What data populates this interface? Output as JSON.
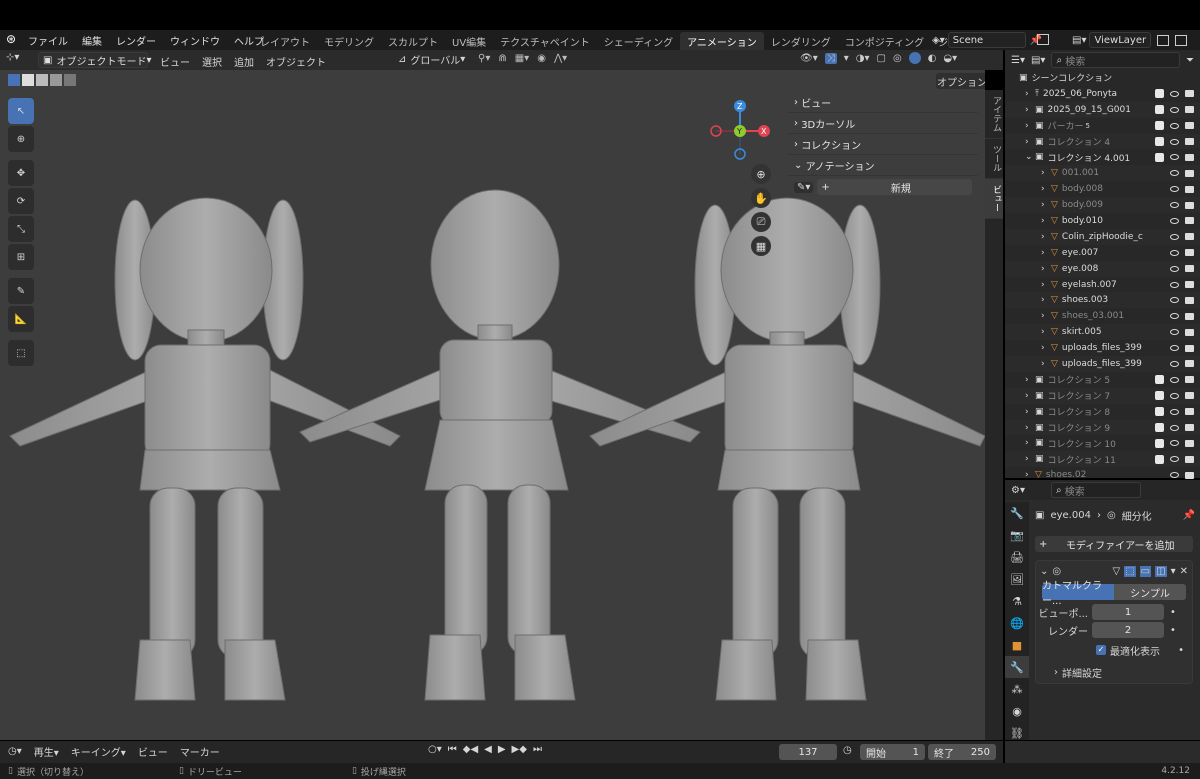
{
  "app": {
    "logo": "blender-icon"
  },
  "menu": [
    "ファイル",
    "編集",
    "レンダー",
    "ウィンドウ",
    "ヘルプ"
  ],
  "workspaces": [
    {
      "label": "レイアウト",
      "active": false
    },
    {
      "label": "モデリング",
      "active": false
    },
    {
      "label": "スカルプト",
      "active": false
    },
    {
      "label": "UV編集",
      "active": false
    },
    {
      "label": "テクスチャペイント",
      "active": false
    },
    {
      "label": "シェーディング",
      "active": false
    },
    {
      "label": "アニメーション",
      "active": true
    },
    {
      "label": "レンダリング",
      "active": false
    },
    {
      "label": "コンポジティング",
      "active": false
    },
    {
      "label": "ジオメト",
      "active": false
    }
  ],
  "scene": {
    "name": "Scene",
    "view_layer": "ViewLayer"
  },
  "viewport": {
    "mode": "オブジェクトモード",
    "menus": [
      "ビュー",
      "選択",
      "追加",
      "オブジェクト"
    ],
    "orientation": "グローバル",
    "options_label": "オプション",
    "npanel": {
      "rows": [
        "ビュー",
        "3Dカーソル",
        "コレクション",
        "アノテーション"
      ],
      "new_button": "新規"
    },
    "side_tabs": [
      "アイテム",
      "ツール",
      "ビュー"
    ],
    "gizmo": {
      "x": "X",
      "y": "Y",
      "z": "Z"
    }
  },
  "outliner": {
    "search_placeholder": "検索",
    "root": "シーンコレクション",
    "items": [
      {
        "name": "2025_06_Ponyta",
        "indent": 1,
        "kind": "import",
        "dim": false
      },
      {
        "name": "2025_09_15_G001",
        "indent": 1,
        "kind": "collection",
        "dim": false
      },
      {
        "name": "パーカー",
        "indent": 1,
        "kind": "collection",
        "dim": true,
        "badge": "5"
      },
      {
        "name": "コレクション 4",
        "indent": 1,
        "kind": "collection",
        "dim": true
      },
      {
        "name": "コレクション 4.001",
        "indent": 1,
        "kind": "collection",
        "dim": false,
        "expanded": true
      },
      {
        "name": "001.001",
        "indent": 2,
        "kind": "mesh",
        "dim": true
      },
      {
        "name": "body.008",
        "indent": 2,
        "kind": "mesh",
        "dim": true
      },
      {
        "name": "body.009",
        "indent": 2,
        "kind": "mesh",
        "dim": true
      },
      {
        "name": "body.010",
        "indent": 2,
        "kind": "mesh",
        "dim": false
      },
      {
        "name": "Colin_zipHoodie_c",
        "indent": 2,
        "kind": "mesh",
        "dim": false
      },
      {
        "name": "eye.007",
        "indent": 2,
        "kind": "mesh",
        "dim": false
      },
      {
        "name": "eye.008",
        "indent": 2,
        "kind": "mesh",
        "dim": false
      },
      {
        "name": "eyelash.007",
        "indent": 2,
        "kind": "mesh",
        "dim": false
      },
      {
        "name": "shoes.003",
        "indent": 2,
        "kind": "mesh",
        "dim": false
      },
      {
        "name": "shoes_03.001",
        "indent": 2,
        "kind": "mesh",
        "dim": true
      },
      {
        "name": "skirt.005",
        "indent": 2,
        "kind": "mesh",
        "dim": false
      },
      {
        "name": "uploads_files_399",
        "indent": 2,
        "kind": "mesh",
        "dim": false
      },
      {
        "name": "uploads_files_399",
        "indent": 2,
        "kind": "mesh",
        "dim": false
      },
      {
        "name": "コレクション 5",
        "indent": 1,
        "kind": "collection",
        "dim": true
      },
      {
        "name": "コレクション 7",
        "indent": 1,
        "kind": "collection",
        "dim": true
      },
      {
        "name": "コレクション 8",
        "indent": 1,
        "kind": "collection",
        "dim": true
      },
      {
        "name": "コレクション 9",
        "indent": 1,
        "kind": "collection",
        "dim": true
      },
      {
        "name": "コレクション 10",
        "indent": 1,
        "kind": "collection",
        "dim": true
      },
      {
        "name": "コレクション 11",
        "indent": 1,
        "kind": "collection",
        "dim": true
      },
      {
        "name": "shoes.02",
        "indent": 1,
        "kind": "mesh",
        "dim": true
      }
    ]
  },
  "properties": {
    "search_placeholder": "検索",
    "object": "eye.004",
    "modifier_name": "細分化",
    "add_modifier": "モディファイアーを追加",
    "subdiv_tabs": [
      "カトマルクラー...",
      "シンプル"
    ],
    "viewport_label": "ビューポ...",
    "viewport_value": "1",
    "render_label": "レンダー",
    "render_value": "2",
    "optimal_label": "最適化表示",
    "advanced_label": "詳細設定",
    "version": "4.2.12"
  },
  "timeline": {
    "menus": [
      "再生",
      "キーイング",
      "ビュー",
      "マーカー"
    ],
    "current_frame": "137",
    "start_label": "開始",
    "start": "1",
    "end_label": "終了",
    "end": "250"
  },
  "status": {
    "select": "選択（切り替え）",
    "pan": "ドリービュー",
    "lasso": "投げ縄選択"
  },
  "colors": {
    "accent": "#4772b3",
    "x": "#e04352",
    "y": "#8fcc2b",
    "z": "#3b8be0",
    "mesh": "#e09235"
  }
}
